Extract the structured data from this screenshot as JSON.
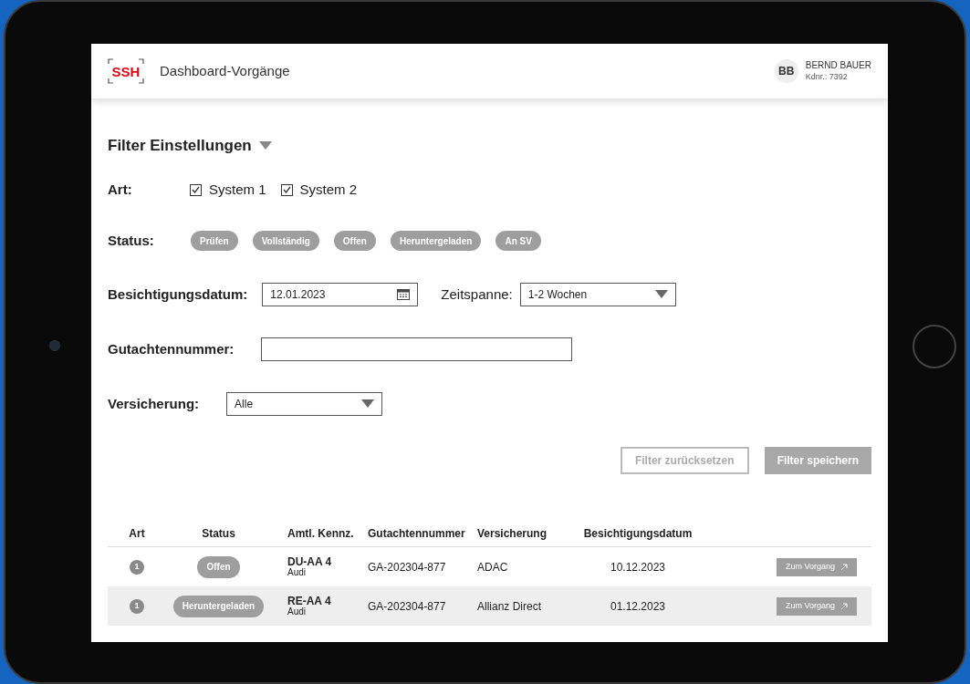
{
  "header": {
    "logo": "SSH",
    "title": "Dashboard-Vorgänge",
    "user": {
      "initials": "BB",
      "name": "BERND BAUER",
      "customer_no": "Kdnr.: 7392"
    }
  },
  "filter": {
    "title": "Filter Einstellungen",
    "expanded": true,
    "art": {
      "label": "Art:",
      "options": [
        {
          "label": "System 1",
          "checked": true
        },
        {
          "label": "System 2",
          "checked": true
        }
      ]
    },
    "status": {
      "label": "Status:",
      "pills": [
        "Prüfen",
        "Vollständig",
        "Offen",
        "Heruntergeladen",
        "An SV"
      ]
    },
    "date": {
      "label": "Besichtigungsdatum:",
      "value": "12.01.2023"
    },
    "period": {
      "label": "Zeitspanne:",
      "value": "1-2 Wochen"
    },
    "report_number": {
      "label": "Gutachtennummer:"
    },
    "insurance": {
      "label": "Versicherung:",
      "value": "Alle"
    },
    "buttons": [
      {
        "label": "Filter zurücksetzen",
        "kind": "secondary"
      },
      {
        "label": "Filter speichern",
        "kind": "primary"
      }
    ]
  },
  "table": {
    "columns": [
      "Art",
      "Status",
      "Amtl. Kennz.",
      "Gutachtennummer",
      "Versicherung",
      "Besichtigungsdatum"
    ],
    "rows": [
      {
        "art": "1",
        "status": "Offen",
        "plate": "DU-AA 4",
        "make": "Audi",
        "number": "GA-202304-877",
        "insurance": "ADAC",
        "date": "10.12.2023",
        "action": "Zum Vorgang"
      },
      {
        "art": "1",
        "status": "Heruntergeladen",
        "plate": "RE-AA 4",
        "make": "Audi",
        "number": "GA-202304-877",
        "insurance": "Allianz Direct",
        "date": "01.12.2023",
        "action": "Zum Vorgang"
      }
    ]
  }
}
